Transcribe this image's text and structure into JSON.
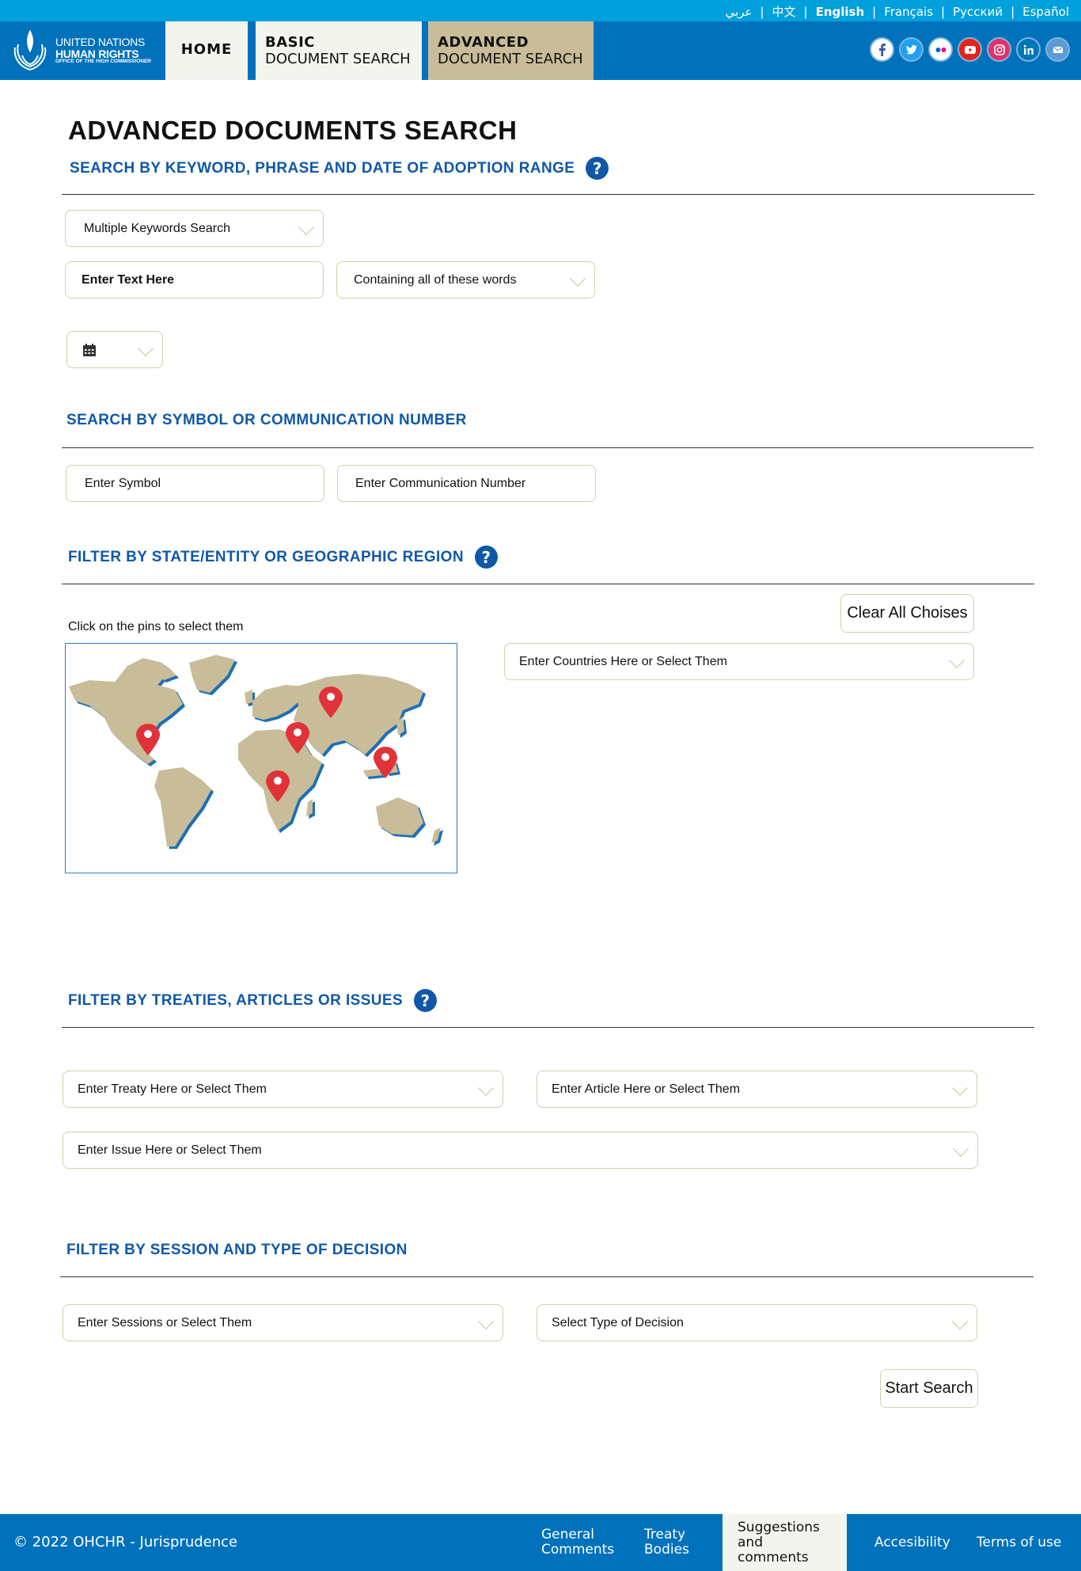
{
  "languages": [
    {
      "label": "عربي",
      "active": false
    },
    {
      "label": "中文",
      "active": false
    },
    {
      "label": "English",
      "active": true
    },
    {
      "label": "Français",
      "active": false
    },
    {
      "label": "Русский",
      "active": false
    },
    {
      "label": "Español",
      "active": false
    }
  ],
  "brand": {
    "line1": "UNITED NATIONS",
    "line2": "HUMAN RIGHTS",
    "line3": "OFFICE OF THE HIGH COMMISSIONER"
  },
  "nav": {
    "home": "HOME",
    "basic_l1": "BASIC",
    "basic_l2": "DOCUMENT SEARCH",
    "advanced_l1": "ADVANCED",
    "advanced_l2": "DOCUMENT SEARCH"
  },
  "social": [
    "facebook-icon",
    "twitter-icon",
    "flickr-icon",
    "youtube-icon",
    "instagram-icon",
    "linkedin-icon",
    "email-icon"
  ],
  "page_title": "ADVANCED DOCUMENTS SEARCH",
  "sections": {
    "keyword": {
      "title": "SEARCH BY KEYWORD, PHRASE AND DATE OF ADOPTION RANGE",
      "search_mode": "Multiple Keywords Search",
      "text_placeholder": "Enter Text Here",
      "match_mode": "Containing all of these words"
    },
    "symbol": {
      "title": "SEARCH BY SYMBOL OR COMMUNICATION NUMBER",
      "symbol_placeholder": "Enter Symbol",
      "comm_placeholder": "Enter Communication Number"
    },
    "region": {
      "title": "FILTER BY STATE/ENTITY OR GEOGRAPHIC REGION",
      "map_hint": "Click on the pins to select them",
      "clear_label": "Clear All Choises",
      "countries_placeholder": "Enter Countries Here or Select Them"
    },
    "treaties": {
      "title": "FILTER BY TREATIES, ARTICLES OR ISSUES",
      "treaty_placeholder": "Enter Treaty Here or Select Them",
      "article_placeholder": "Enter Article Here or Select Them",
      "issue_placeholder": "Enter Issue Here or Select Them"
    },
    "session": {
      "title": "FILTER BY SESSION AND TYPE OF DECISION",
      "sessions_placeholder": "Enter Sessions or Select Them",
      "decision_placeholder": "Select Type of Decision",
      "search_label": "Start Search"
    }
  },
  "help_glyph": "?",
  "colors": {
    "top_bar": "#00a0dc",
    "header": "#0072bc",
    "section_title": "#0f58a8",
    "active_tab": "#c8bd98",
    "pin": "#e03238",
    "land": "#c8bd98"
  },
  "footer": {
    "copyright": "© 2022 OHCHR - Jurisprudence",
    "links": [
      {
        "l1": "General",
        "l2": "Comments"
      },
      {
        "l1": "Treaty",
        "l2": "Bodies"
      },
      {
        "l1": "Suggestions",
        "l2": "and comments"
      },
      {
        "l1": "Accesibility",
        "l2": ""
      },
      {
        "l1": "Terms of use",
        "l2": ""
      }
    ]
  }
}
